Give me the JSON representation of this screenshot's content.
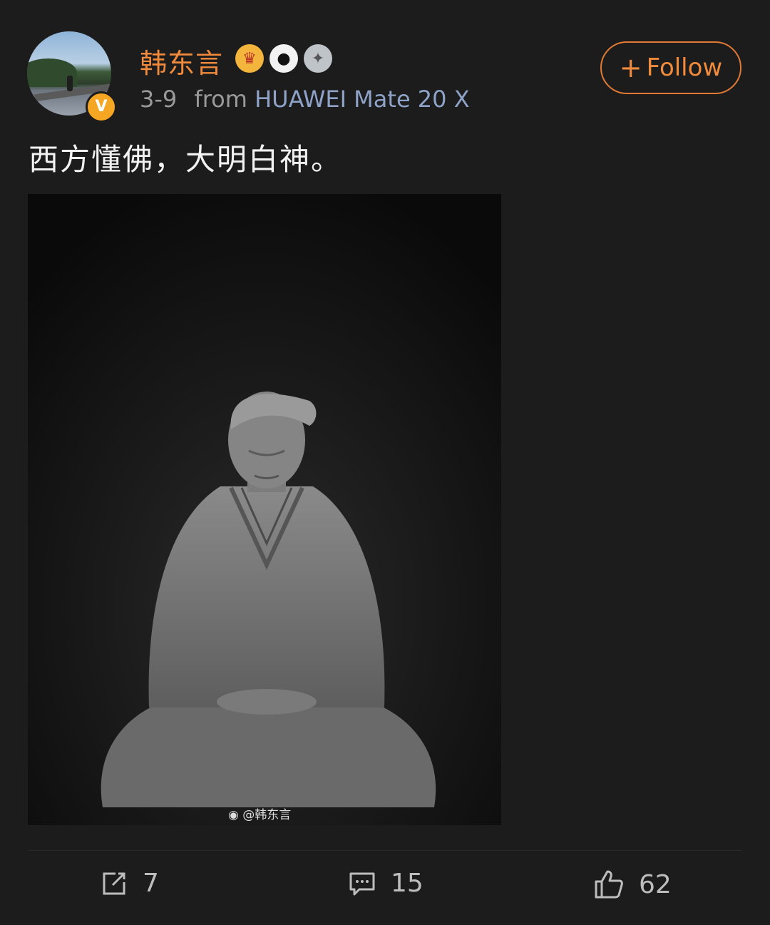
{
  "post": {
    "author": "韩东言",
    "verified_mark": "V",
    "badges": [
      "crown-badge",
      "panda-badge",
      "medal-badge"
    ],
    "date": "3-9",
    "from_label": "from",
    "source": "HUAWEI Mate 20 X",
    "follow_label": "Follow",
    "text": "西方懂佛，大明白神。",
    "image_watermark": "@韩东言"
  },
  "actions": {
    "share_count": "7",
    "comment_count": "15",
    "like_count": "62"
  },
  "colors": {
    "accent": "#f08a3c",
    "background": "#1c1c1c",
    "source_link": "#8ea3c7"
  }
}
